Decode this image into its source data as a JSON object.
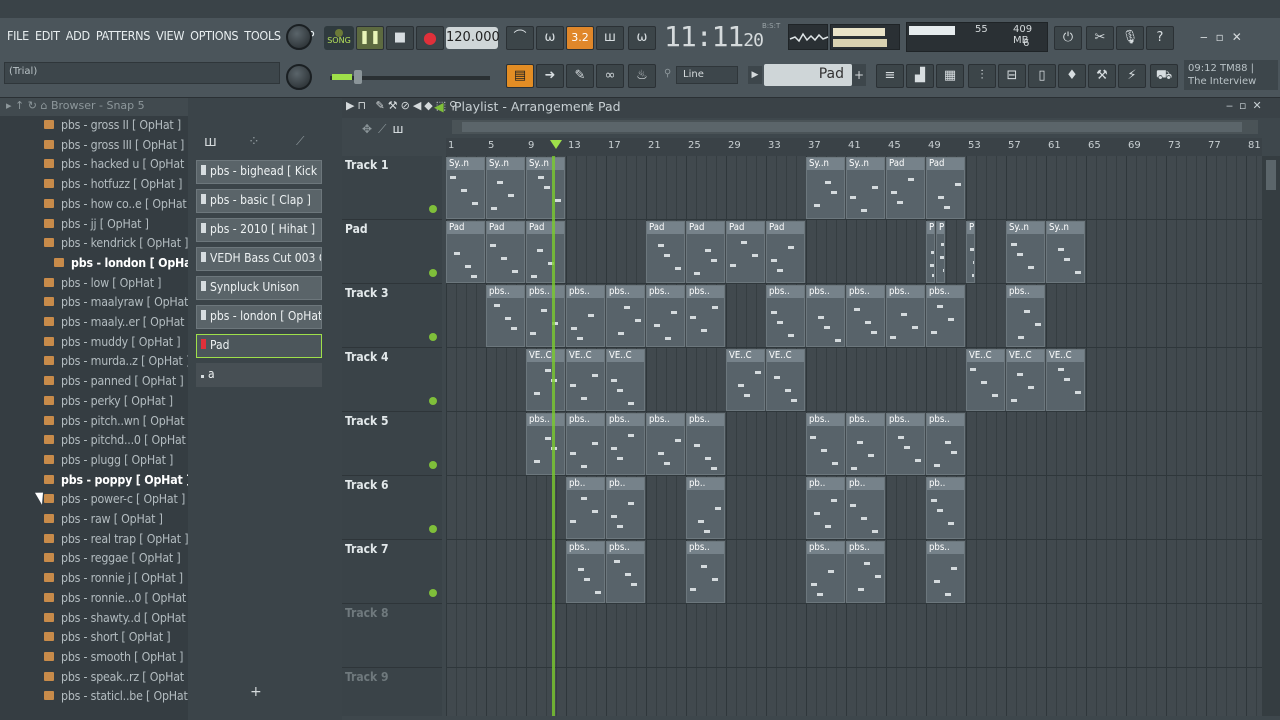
{
  "menu": [
    "FILE",
    "EDIT",
    "ADD",
    "PATTERNS",
    "VIEW",
    "OPTIONS",
    "TOOLS",
    "HELP"
  ],
  "hint": "(Trial)",
  "transport": {
    "mode": "SONG",
    "tempo": "120.000",
    "time": "11:11",
    "time_ticks": "20",
    "time_unit": "B:S:T"
  },
  "snap_mode": "Line",
  "pattern_name": "Pad",
  "memory": {
    "mb": "409 MB",
    "cpu": "55",
    "poly": "6"
  },
  "news": {
    "line1": "09:12",
    "line2": "TM88 |",
    "line3": "The Interview"
  },
  "browser": {
    "title": "Browser - Snap 5",
    "items": [
      "pbs - gross II [ OpHat ]",
      "pbs - gross III [ OpHat ]",
      "pbs - hacked u [ OpHat ]",
      "pbs - hotfuzz [ OpHat ]",
      "pbs - how co..e [ OpHat ]",
      "pbs - jj [ OpHat ]",
      "pbs - kendrick [ OpHat ]",
      "pbs - london [ OpHat ]",
      "pbs - low [ OpHat ]",
      "pbs - maalyraw [ OpHat ]",
      "pbs - maaly..er [ OpHat ]",
      "pbs - muddy [ OpHat ]",
      "pbs - murda..z [ OpHat ]",
      "pbs - panned [ OpHat ]",
      "pbs - perky [ OpHat ]",
      "pbs - pitch..wn [ OpHat ]",
      "pbs - pitchd...0 [ OpHat ]",
      "pbs - plugg [ OpHat ]",
      "pbs - poppy [ OpHat ]",
      "pbs - power-c [ OpHat ]",
      "pbs - raw [ OpHat ]",
      "pbs - real trap [ OpHat ]",
      "pbs - reggae [ OpHat ]",
      "pbs - ronnie j [ OpHat ]",
      "pbs - ronnie...0 [ OpHat ]",
      "pbs - shawty..d [ OpHat ]",
      "pbs - short [ OpHat ]",
      "pbs - smooth [ OpHat ]",
      "pbs - speak..rz [ OpHat ]",
      "pbs - staticl..be [ OpHat ]"
    ]
  },
  "channels": [
    "pbs - bighead [ Kick",
    "pbs - basic [ Clap ]",
    "pbs - 2010 [ Hihat ]",
    "VEDH Bass Cut 003 C",
    "Synpluck Unison",
    "pbs - london [ OpHat",
    "Pad",
    "a"
  ],
  "playlist": {
    "title": "Playlist - Arrangement",
    "crumb": "Pad",
    "ruler": [
      "1",
      "5",
      "9",
      "13",
      "17",
      "21",
      "25",
      "29",
      "33",
      "37",
      "41",
      "45",
      "49",
      "53",
      "57",
      "61",
      "65",
      "69",
      "73",
      "77",
      "81"
    ],
    "tracks": [
      "Track 1",
      "Pad",
      "Track 3",
      "Track 4",
      "Track 5",
      "Track 6",
      "Track 7",
      "Track 8",
      "Track 9"
    ],
    "clip_labels": {
      "t1": "Sy..n",
      "pad": "Pad",
      "pad2": "Sy..n",
      "t3": "pbs..",
      "t4": "VE..C",
      "t5": "pbs..",
      "t6": "pb..",
      "t7": "pbs.."
    }
  }
}
